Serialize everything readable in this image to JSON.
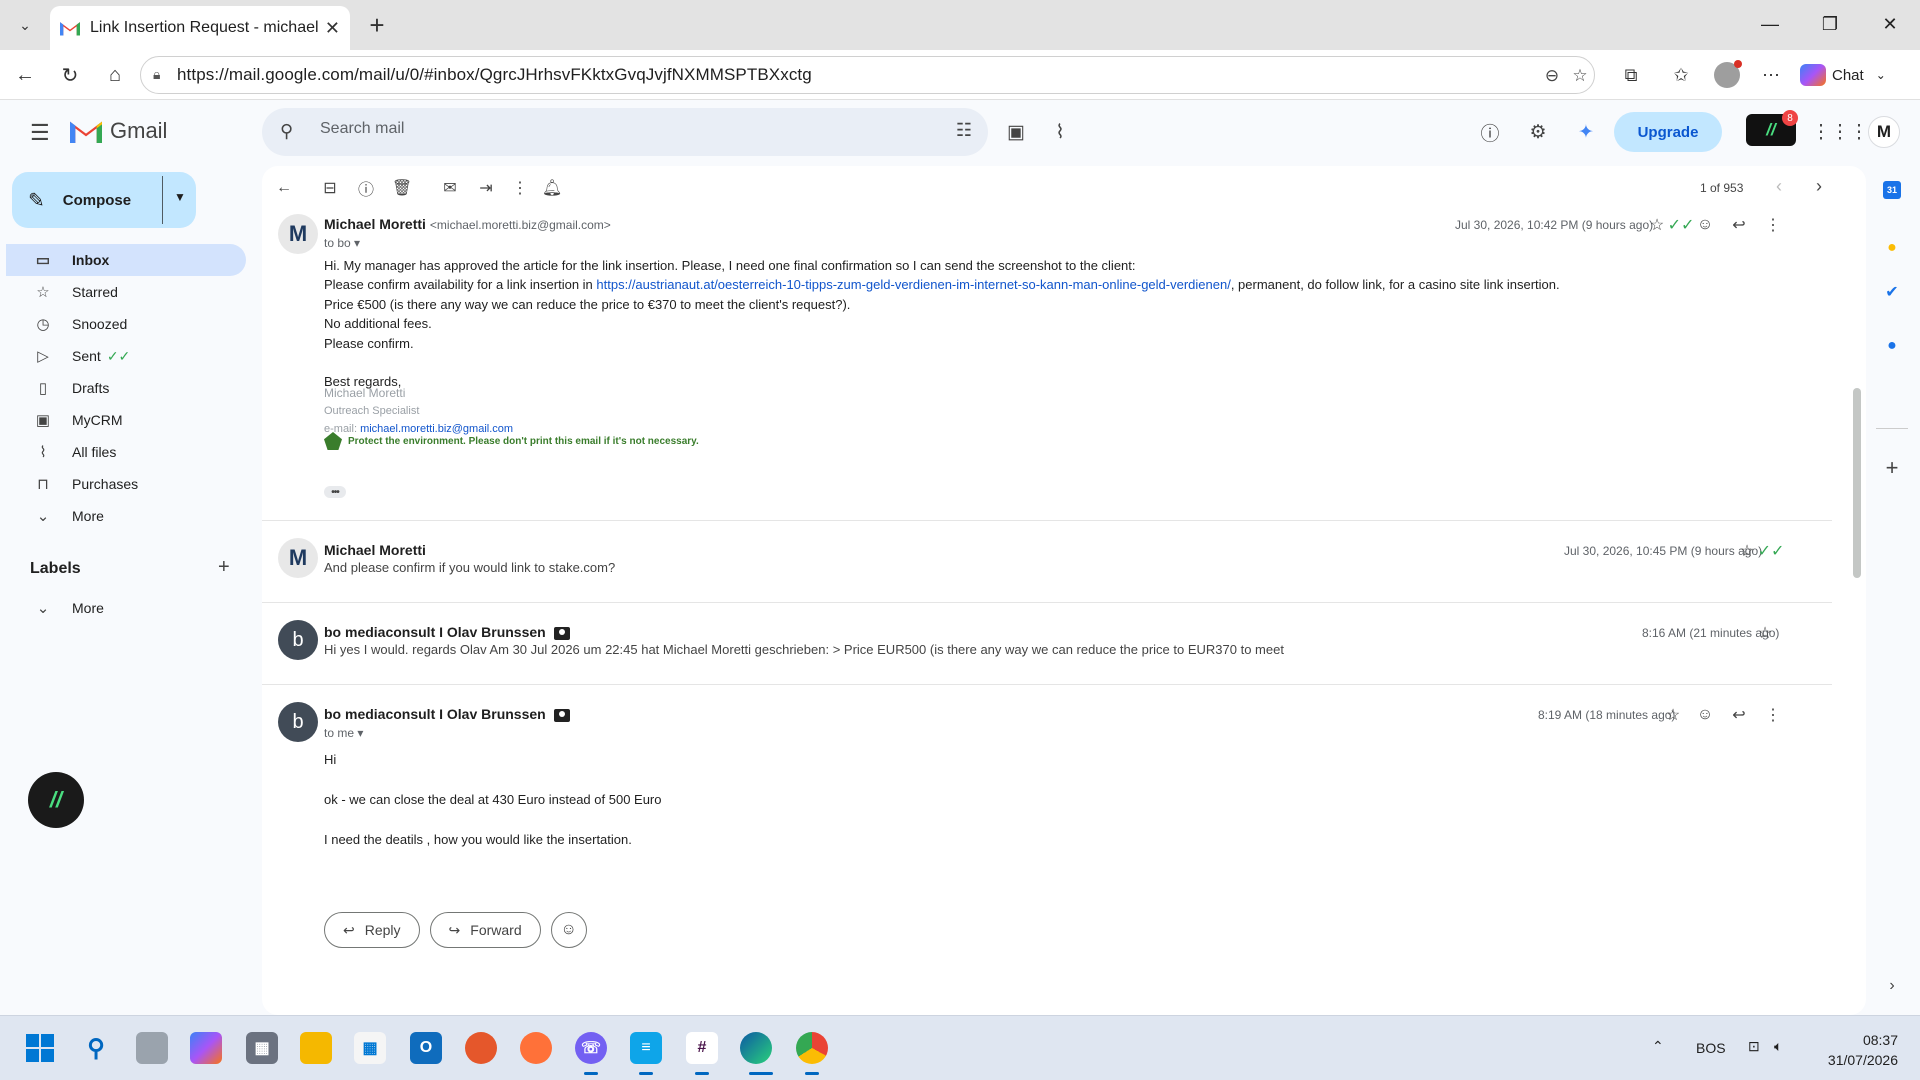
{
  "browser": {
    "tab_title": "Link Insertion Request - michael.m",
    "url": "https://mail.google.com/mail/u/0/#inbox/QgrcJHrhsvFKktxGvqJvjfNXMMSPTBXxctg",
    "chat_label": "Chat"
  },
  "gmail": {
    "logo_text": "Gmail",
    "search_placeholder": "Search mail",
    "upgrade_label": "Upgrade",
    "extension_badge_count": "8",
    "account_initial": "M"
  },
  "sidebar": {
    "compose_label": "Compose",
    "items": [
      {
        "label": "Inbox",
        "icon": "inbox-icon",
        "active": true
      },
      {
        "label": "Starred",
        "icon": "star-icon"
      },
      {
        "label": "Snoozed",
        "icon": "clock-icon"
      },
      {
        "label": "Sent",
        "icon": "send-icon"
      },
      {
        "label": "Drafts",
        "icon": "draft-icon"
      },
      {
        "label": "MyCRM",
        "icon": "contact-icon"
      },
      {
        "label": "All files",
        "icon": "paperclip-icon"
      },
      {
        "label": "Purchases",
        "icon": "bag-icon"
      },
      {
        "label": "More",
        "icon": "chevron-down-icon"
      }
    ],
    "labels_header": "Labels",
    "labels_more": "More"
  },
  "toolbar": {
    "pager_text": "1 of 953"
  },
  "messages": [
    {
      "sender": "Michael Moretti",
      "email": "<michael.moretti.biz@gmail.com>",
      "to": "to bo",
      "date": "Jul 30, 2026, 10:42 PM (9 hours ago)",
      "line1": "Hi. My manager has approved the article for the link insertion. Please, I need one final confirmation so I can send the screenshot to the client:",
      "line2_pre": "Please confirm availability for a link insertion in ",
      "link": "https://austrianaut.at/oesterreich-10-tipps-zum-geld-verdienen-im-internet-so-kann-man-online-geld-verdienen/",
      "line2_post": ", permanent, do follow link, for a casino site link insertion.",
      "line3": "Price  €500 (is there any way we can reduce the price to €370 to meet the client's request?).",
      "line4": "No additional fees.",
      "line5": "Please confirm.",
      "closing": "Best regards,",
      "sig_name": "Michael Moretti",
      "sig_title": "Outreach Specialist",
      "sig_email_label": "e-mail: ",
      "sig_email": "michael.moretti.biz@gmail.com",
      "eco_note": "Protect the environment. Please don't print this email if it's not necessary."
    },
    {
      "sender": "Michael Moretti",
      "date": "Jul 30, 2026, 10:45 PM (9 hours ago)",
      "snippet": "And please confirm if you would link to stake.com?"
    },
    {
      "sender": "bo mediaconsult I Olav Brunssen",
      "date": "8:16 AM (21 minutes ago)",
      "snippet": "Hi yes I would. regards Olav Am 30 Jul 2026 um 22:45 hat Michael Moretti geschrieben: > Price EUR500 (is there any way we can reduce the price to EUR370 to meet"
    },
    {
      "sender": "bo mediaconsult I Olav Brunssen",
      "to": "to me",
      "date": "8:19 AM (18 minutes ago)",
      "line1": "Hi",
      "line2": "ok - we can close the deal at 430 Euro instead of 500 Euro",
      "line3": "I need the deatils , how you would like the insertation."
    }
  ],
  "actions": {
    "reply": "Reply",
    "forward": "Forward"
  },
  "taskbar": {
    "lang": "BOS",
    "time": "08:37",
    "date": "31/07/2026"
  },
  "colors": {
    "accent": "#0b57d0",
    "compose_bg": "#c2e7ff",
    "active_nav": "#d3e3fd",
    "read_check": "#34a853"
  }
}
